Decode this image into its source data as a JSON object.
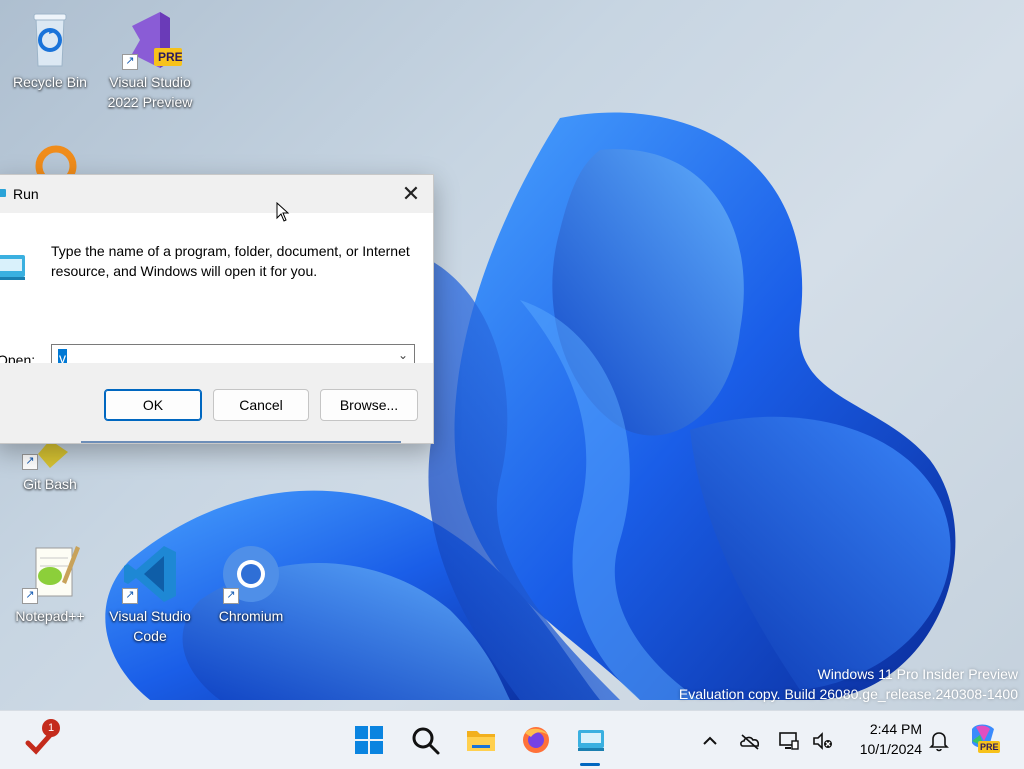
{
  "desktop": {
    "icons": [
      {
        "label": "Recycle Bin",
        "icon": "recycle-bin-icon"
      },
      {
        "label": "Visual Studio 2022 Preview",
        "icon": "visual-studio-preview-icon",
        "badge": "PRE"
      },
      {
        "label": "Git Bash",
        "icon": "git-bash-icon"
      },
      {
        "label": "Notepad++",
        "icon": "notepad-plus-plus-icon"
      },
      {
        "label": "Visual Studio Code",
        "icon": "vscode-icon"
      },
      {
        "label": "Chromium",
        "icon": "chromium-icon"
      }
    ],
    "watermark": {
      "line1": "Windows 11 Pro Insider Preview",
      "line2": "Evaluation copy. Build 26080.ge_release.240308-1400"
    }
  },
  "run_dialog": {
    "title": "Run",
    "description": "Type the name of a program, folder, document, or Internet resource, and Windows will open it for you.",
    "open_label": "Open:",
    "open_value": "v",
    "buttons": {
      "ok": "OK",
      "cancel": "Cancel",
      "browse": "Browse..."
    }
  },
  "taskbar": {
    "notification_count": "1",
    "time": "2:44 PM",
    "date": "10/1/2024",
    "copilot_badge": "PRE"
  },
  "colors": {
    "accent": "#0067c0",
    "wallpaper_bloom": "#1a5ee8",
    "taskbar_bg": "#eef2f7"
  }
}
